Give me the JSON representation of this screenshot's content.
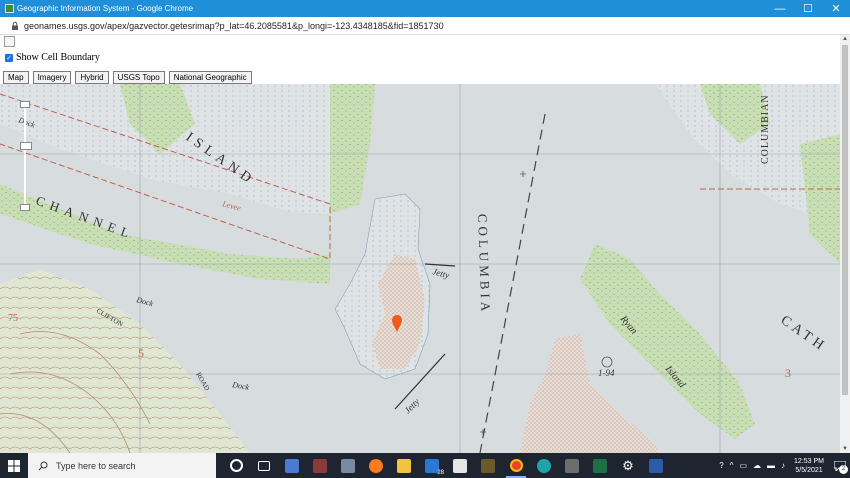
{
  "window": {
    "title": "Geographic Information System - Google Chrome",
    "minimize_glyph": "—",
    "maximize_glyph": "☐",
    "close_glyph": "✕"
  },
  "address": {
    "url": "geonames.usgs.gov/apex/gazvector.getesrimap?p_lat=46.2085581&p_longi=-123.4348185&fid=1851730"
  },
  "page": {
    "checkbox_label": "Show Cell Boundary",
    "checkbox_checked": true,
    "map_types": [
      "Map",
      "Imagery",
      "Hybrid",
      "USGS Topo",
      "National Geographic"
    ]
  },
  "map_labels": {
    "island": "ISLAND",
    "channel": "CHANNEL",
    "columbia_main": "COLUMBIA",
    "columbian_top": "COLUMBIAN",
    "cath": "CATH",
    "jetty1": "Jetty",
    "jetty2": "Jetty",
    "ryan": "Ryan",
    "island_ryan": "Island",
    "dock1": "Dock",
    "dock2": "Dock",
    "dock3": "Dock",
    "levee": "Levee",
    "clifton": "CLIFTON",
    "road": "ROAD",
    "num_3": "3",
    "num_75": "75",
    "num_194": "1-94",
    "num_5": "5"
  },
  "taskbar": {
    "search_placeholder": "Type here to search",
    "mail_badge": "28",
    "time": "12:53 PM",
    "date": "5/5/2021",
    "notification_count": "2"
  },
  "colors": {
    "titlebar": "#1e8fd8",
    "taskbar": "#1f2530",
    "marsh": "#c9dfb2",
    "water": "#d7dcdf",
    "marker": "#f05a1a"
  }
}
